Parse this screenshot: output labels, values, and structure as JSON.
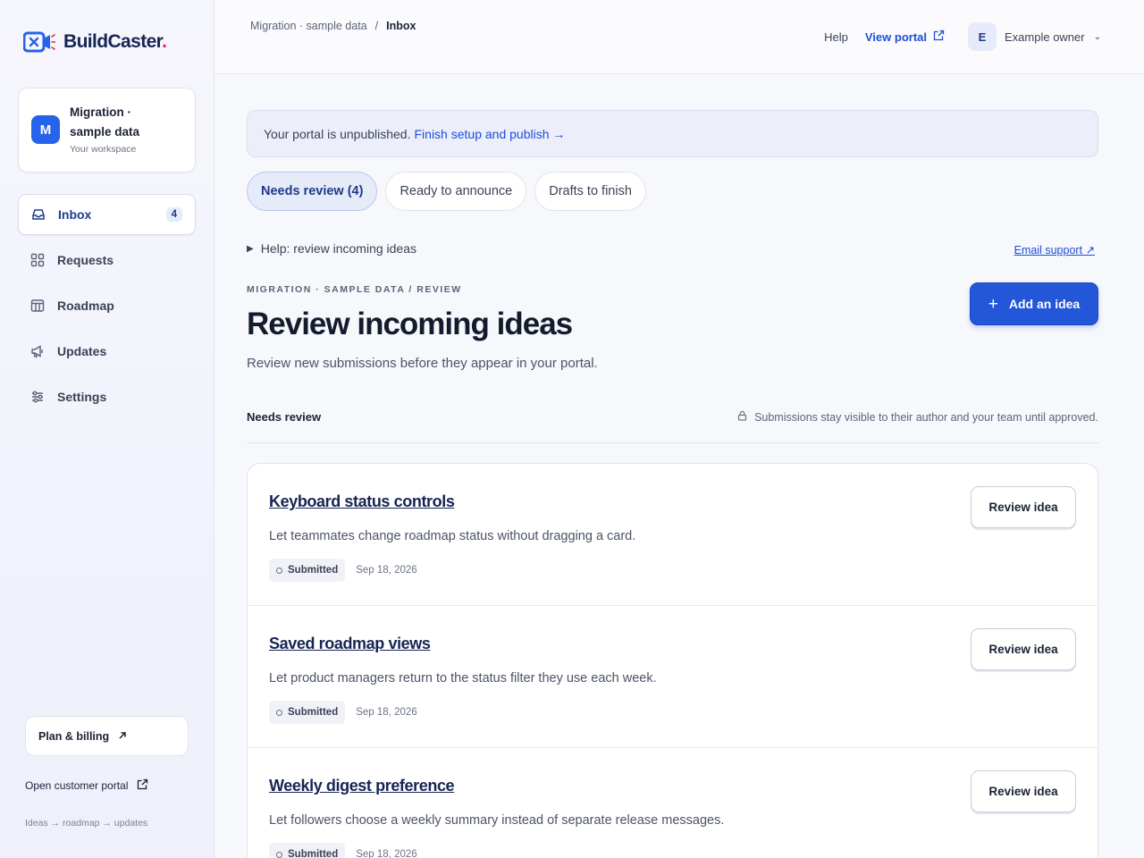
{
  "brand": {
    "name": "BuildCaster",
    "dot": ".",
    "accent": "#2563eb",
    "dot_color": "#e0245e"
  },
  "workspace": {
    "initial": "M",
    "name": "Migration · sample data",
    "subtitle": "Your workspace"
  },
  "nav": [
    {
      "label": "Inbox",
      "icon": "inbox-icon",
      "badge": "4",
      "active": true
    },
    {
      "label": "Requests",
      "icon": "grid-icon"
    },
    {
      "label": "Roadmap",
      "icon": "roadmap-icon"
    },
    {
      "label": "Updates",
      "icon": "megaphone-icon"
    },
    {
      "label": "Settings",
      "icon": "sliders-icon"
    }
  ],
  "sidebar_footer": {
    "plan_label": "Plan & billing",
    "open_portal_label": "Open customer portal",
    "flow_text": "Ideas → roadmap → updates"
  },
  "breadcrumb": {
    "parent": "Migration · sample data",
    "separator": "/",
    "current": "Inbox"
  },
  "topbar": {
    "help": "Help",
    "view_portal": "View portal",
    "user_initial": "E",
    "user_name": "Example owner"
  },
  "banner": {
    "text": "Your portal is unpublished.",
    "link": "Finish setup and publish →"
  },
  "tabs": [
    {
      "label": "Needs review (4)",
      "active": true
    },
    {
      "label": "Ready to announce"
    },
    {
      "label": "Drafts to finish"
    }
  ],
  "help_toggle": "Help: review incoming ideas",
  "email_support": "Email support ↗",
  "page": {
    "eyebrow": "MIGRATION · SAMPLE DATA / REVIEW",
    "title": "Review incoming ideas",
    "subtitle": "Review new submissions before they appear in your portal.",
    "add_button": "Add an idea"
  },
  "section": {
    "title": "Needs review",
    "note": "Submissions stay visible to their author and your team until approved."
  },
  "ideas": [
    {
      "title": "Keyboard status controls",
      "description": "Let teammates change roadmap status without dragging a card.",
      "status": "Submitted",
      "date": "Sep 18, 2026",
      "action": "Review idea"
    },
    {
      "title": "Saved roadmap views",
      "description": "Let product managers return to the status filter they use each week.",
      "status": "Submitted",
      "date": "Sep 18, 2026",
      "action": "Review idea"
    },
    {
      "title": "Weekly digest preference",
      "description": "Let followers choose a weekly summary instead of separate release messages.",
      "status": "Submitted",
      "date": "Sep 18, 2026",
      "action": "Review idea"
    }
  ]
}
